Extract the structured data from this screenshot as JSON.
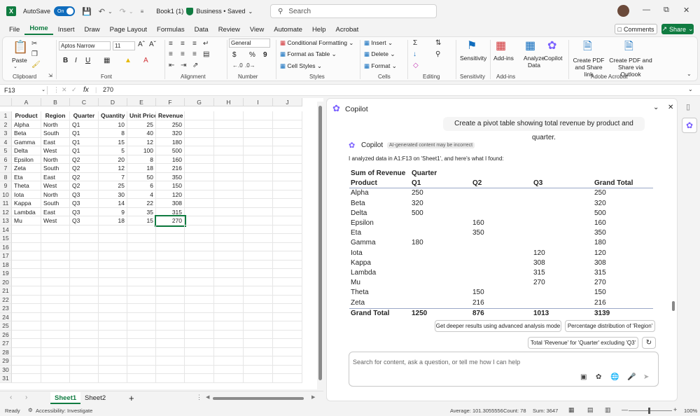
{
  "titlebar": {
    "app_icon": "X",
    "autosave_label": "AutoSave",
    "autosave_state": "On",
    "doc_title": "Book1 (1)",
    "label_text": "Business • Saved",
    "search_placeholder": "Search"
  },
  "menu": {
    "items": [
      "File",
      "Home",
      "Insert",
      "Draw",
      "Page Layout",
      "Formulas",
      "Data",
      "Review",
      "View",
      "Automate",
      "Help",
      "Acrobat"
    ],
    "active": "Home",
    "comments": "Comments",
    "share": "Share"
  },
  "ribbon": {
    "paste": "Paste",
    "clipboard": "Clipboard",
    "font_name": "Aptos Narrow",
    "font_size": "11",
    "font": "Font",
    "alignment": "Alignment",
    "number_format": "General",
    "number": "Number",
    "cond_format": "Conditional Formatting",
    "format_table": "Format as Table",
    "cell_styles": "Cell Styles",
    "styles": "Styles",
    "insert": "Insert",
    "delete": "Delete",
    "format": "Format",
    "cells": "Cells",
    "editing": "Editing",
    "sensitivity": "Sensitivity",
    "addins": "Add-ins",
    "analyze": "Analyze Data",
    "copilot": "Copilot",
    "create_pdf_link": "Create PDF and Share link",
    "create_pdf_outlook": "Create PDF and Share via Outlook",
    "adobe": "Adobe Acrobat",
    "bold": "B",
    "italic": "I",
    "underline": "U",
    "currency": "$",
    "percent": "%",
    "comma": "9"
  },
  "formula": {
    "name_box": "F13",
    "fx": "fx",
    "value": "270"
  },
  "sheet": {
    "columns": [
      "A",
      "B",
      "C",
      "D",
      "E",
      "F",
      "G",
      "H",
      "I",
      "J"
    ],
    "headers": [
      "Product",
      "Region",
      "Quarter",
      "Quantity",
      "Unit Price",
      "Revenue"
    ],
    "rows": [
      [
        "Alpha",
        "North",
        "Q1",
        "10",
        "25",
        "250"
      ],
      [
        "Beta",
        "South",
        "Q1",
        "8",
        "40",
        "320"
      ],
      [
        "Gamma",
        "East",
        "Q1",
        "15",
        "12",
        "180"
      ],
      [
        "Delta",
        "West",
        "Q1",
        "5",
        "100",
        "500"
      ],
      [
        "Epsilon",
        "North",
        "Q2",
        "20",
        "8",
        "160"
      ],
      [
        "Zeta",
        "South",
        "Q2",
        "12",
        "18",
        "216"
      ],
      [
        "Eta",
        "East",
        "Q2",
        "7",
        "50",
        "350"
      ],
      [
        "Theta",
        "West",
        "Q2",
        "25",
        "6",
        "150"
      ],
      [
        "Iota",
        "North",
        "Q3",
        "30",
        "4",
        "120"
      ],
      [
        "Kappa",
        "South",
        "Q3",
        "14",
        "22",
        "308"
      ],
      [
        "Lambda",
        "East",
        "Q3",
        "9",
        "35",
        "315"
      ],
      [
        "Mu",
        "West",
        "Q3",
        "18",
        "15",
        "270"
      ]
    ],
    "row_numbers": [
      "1",
      "2",
      "3",
      "4",
      "5",
      "6",
      "7",
      "8",
      "9",
      "10",
      "11",
      "12",
      "13",
      "14",
      "15",
      "16",
      "17",
      "18",
      "19",
      "20",
      "21",
      "22",
      "23",
      "24",
      "25",
      "26",
      "27",
      "28",
      "29",
      "30",
      "31"
    ],
    "tabs": [
      "Sheet1",
      "Sheet2"
    ],
    "active_tab": "Sheet1",
    "add_tab": "+"
  },
  "copilot": {
    "title": "Copilot",
    "user_prompt": "Create a pivot table showing total revenue by product and quarter.",
    "response_name": "Copilot",
    "disclaimer": "AI-generated content may be incorrect",
    "intro": "I analyzed data in A1:F13 on 'Sheet1', and here's what I found:",
    "pivot_header1": [
      "Sum of Revenue",
      "Quarter",
      "",
      "",
      ""
    ],
    "pivot_header2": [
      "Product",
      "Q1",
      "Q2",
      "Q3",
      "Grand Total"
    ],
    "pivot_rows": [
      [
        "Alpha",
        "250",
        "",
        "",
        "250"
      ],
      [
        "Beta",
        "320",
        "",
        "",
        "320"
      ],
      [
        "Delta",
        "500",
        "",
        "",
        "500"
      ],
      [
        "Epsilon",
        "",
        "160",
        "",
        "160"
      ],
      [
        "Eta",
        "",
        "350",
        "",
        "350"
      ],
      [
        "Gamma",
        "180",
        "",
        "",
        "180"
      ],
      [
        "Iota",
        "",
        "",
        "120",
        "120"
      ],
      [
        "Kappa",
        "",
        "",
        "308",
        "308"
      ],
      [
        "Lambda",
        "",
        "",
        "315",
        "315"
      ],
      [
        "Mu",
        "",
        "",
        "270",
        "270"
      ],
      [
        "Theta",
        "",
        "150",
        "",
        "150"
      ],
      [
        "Zeta",
        "",
        "216",
        "",
        "216"
      ]
    ],
    "pivot_total": [
      "Grand Total",
      "1250",
      "876",
      "1013",
      "3139"
    ],
    "chip1": "Get deeper results using advanced analysis mode",
    "chip2": "Percentage distribution of 'Region'",
    "chip3": "Total 'Revenue' for 'Quarter' excluding 'Q3'",
    "input_placeholder": "Search for content, ask a question, or tell me how I can help"
  },
  "status": {
    "ready": "Ready",
    "accessibility": "Accessibility: Investigate",
    "average": "Average: 101.3055556",
    "count": "Count: 78",
    "sum": "Sum: 3647",
    "zoom": "100%"
  },
  "colors": {
    "excel_green": "#107c41",
    "accent_blue": "#0f6cbd"
  }
}
